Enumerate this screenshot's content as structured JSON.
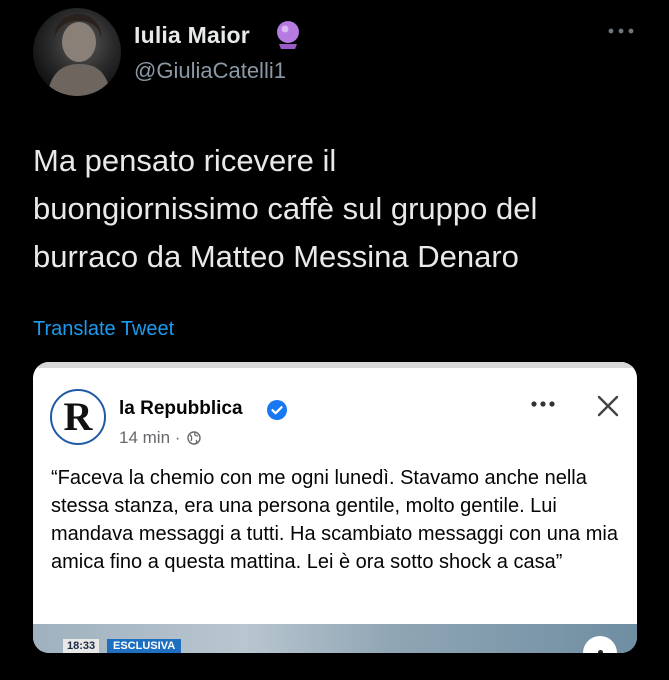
{
  "tweet": {
    "author_name": "Iulia Maior",
    "author_emoji_icon": "crystal-ball-icon",
    "handle": "@GiuliaCatelli1",
    "text_lines": [
      "Ma pensato ricevere il",
      "buongiornissimo caffè sul gruppo del",
      "burraco da Matteo Messina Denaro"
    ],
    "translate_label": "Translate Tweet"
  },
  "embedded_post": {
    "publisher_logo_letter": "R",
    "publisher_name": "la Repubblica",
    "time": "14 min ·",
    "text": "“Faceva la chemio con me ogni lunedì. Stavamo anche nella stessa stanza, era una persona gentile, molto gentile. Lui mandava messaggi a tutti. Ha scambiato messaggi con una mia amica fino a questa mattina. Lei è ora sotto shock a casa”",
    "media_time_badge": "18:33",
    "media_label_badge": "ESCLUSIVA"
  },
  "colors": {
    "background": "#000000",
    "link": "#1d9bf0",
    "verified": "#1877f2"
  }
}
